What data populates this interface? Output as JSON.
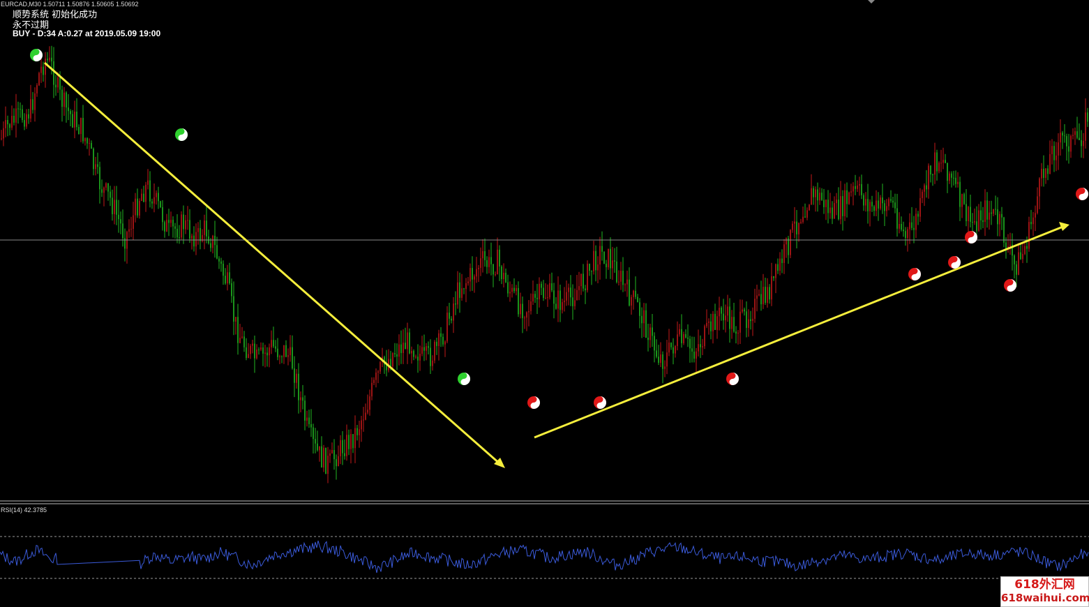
{
  "header": {
    "symbol_quote": "EURCAD,M30  1.50711 1.50876 1.50605 1.50692",
    "status": "顺势系统 初始化成功",
    "expiry": "永不过期",
    "signal": "BUY - D:34 A:0.27 at 2019.05.09 19:00"
  },
  "rsi_panel": {
    "label": "RSI(14) 42.3785",
    "period": 14,
    "value": 42.3785,
    "upper_level": 70,
    "lower_level": 30,
    "line_color": "#3b5bdb"
  },
  "watermark": {
    "line1": "618外汇网",
    "line2": "618waihui.com"
  },
  "colors": {
    "background": "#000000",
    "bull_bar": "#c41a1a",
    "bear_bar": "#22b822",
    "trend_arrow": "#f5ee3c",
    "buy_marker": "#2fd12f",
    "sell_marker": "#e01818",
    "horizontal_line": "#8a8a8a"
  },
  "icons": {
    "marker": "yin-yang-icon"
  },
  "chart_data": {
    "type": "candlestick",
    "timeframe": "M30",
    "symbol": "EURCAD",
    "price_path": [
      0.25,
      0.22,
      0.21,
      0.2,
      0.19,
      0.12,
      0.08,
      0.1,
      0.16,
      0.19,
      0.21,
      0.23,
      0.27,
      0.33,
      0.36,
      0.38,
      0.42,
      0.46,
      0.42,
      0.37,
      0.35,
      0.38,
      0.41,
      0.45,
      0.44,
      0.43,
      0.45,
      0.46,
      0.44,
      0.47,
      0.52,
      0.56,
      0.64,
      0.68,
      0.7,
      0.72,
      0.71,
      0.69,
      0.7,
      0.7,
      0.73,
      0.8,
      0.87,
      0.91,
      0.93,
      0.94,
      0.92,
      0.9,
      0.89,
      0.86,
      0.82,
      0.78,
      0.74,
      0.72,
      0.7,
      0.69,
      0.68,
      0.7,
      0.72,
      0.71,
      0.69,
      0.65,
      0.6,
      0.56,
      0.55,
      0.53,
      0.51,
      0.52,
      0.51,
      0.55,
      0.58,
      0.6,
      0.61,
      0.6,
      0.58,
      0.58,
      0.59,
      0.6,
      0.59,
      0.57,
      0.55,
      0.52,
      0.49,
      0.5,
      0.52,
      0.55,
      0.58,
      0.6,
      0.63,
      0.67,
      0.71,
      0.72,
      0.69,
      0.68,
      0.69,
      0.7,
      0.68,
      0.66,
      0.63,
      0.62,
      0.64,
      0.65,
      0.63,
      0.61,
      0.6,
      0.58,
      0.55,
      0.51,
      0.47,
      0.43,
      0.4,
      0.37,
      0.37,
      0.39,
      0.41,
      0.4,
      0.38,
      0.36,
      0.37,
      0.39,
      0.4,
      0.39,
      0.38,
      0.42,
      0.46,
      0.44,
      0.4,
      0.34,
      0.3,
      0.29,
      0.32,
      0.36,
      0.4,
      0.43,
      0.42,
      0.4,
      0.41,
      0.43,
      0.48,
      0.52,
      0.5,
      0.45,
      0.38,
      0.32,
      0.28,
      0.26,
      0.25,
      0.26,
      0.25,
      0.2
    ],
    "rsi_path": [
      0.55,
      0.5,
      0.45,
      0.5,
      0.58,
      0.62,
      0.55,
      0.48,
      0.5,
      0.56,
      0.6,
      0.5,
      0.4,
      0.35,
      0.45,
      0.5,
      0.42,
      0.35,
      0.3,
      0.42,
      0.5,
      0.55,
      0.5,
      0.45,
      0.48,
      0.5,
      0.52,
      0.48,
      0.5,
      0.56,
      0.58,
      0.54,
      0.5,
      0.44,
      0.4,
      0.45,
      0.5,
      0.55,
      0.58,
      0.6,
      0.62,
      0.64,
      0.66,
      0.68,
      0.66,
      0.62,
      0.6,
      0.55,
      0.5,
      0.45,
      0.4,
      0.36,
      0.4,
      0.45,
      0.5,
      0.55,
      0.58,
      0.56,
      0.52,
      0.5,
      0.48,
      0.45,
      0.42,
      0.4,
      0.42,
      0.46,
      0.5,
      0.55,
      0.58,
      0.6,
      0.62,
      0.6,
      0.58,
      0.55,
      0.5,
      0.52,
      0.54,
      0.56,
      0.58,
      0.6,
      0.55,
      0.5,
      0.45,
      0.4,
      0.42,
      0.46,
      0.5,
      0.56,
      0.6,
      0.62,
      0.64,
      0.66,
      0.65,
      0.62,
      0.58,
      0.55,
      0.52,
      0.5,
      0.48,
      0.5,
      0.52,
      0.5,
      0.48,
      0.46,
      0.45,
      0.44,
      0.42,
      0.4,
      0.38,
      0.42,
      0.46,
      0.48,
      0.5,
      0.52,
      0.54,
      0.52,
      0.5,
      0.48,
      0.5,
      0.52,
      0.54,
      0.56,
      0.58,
      0.56,
      0.52,
      0.5,
      0.48,
      0.46,
      0.5,
      0.54,
      0.56,
      0.58,
      0.56,
      0.54,
      0.55,
      0.56,
      0.58,
      0.6,
      0.58,
      0.55,
      0.5,
      0.45,
      0.4,
      0.38,
      0.42,
      0.5,
      0.55,
      0.52
    ]
  }
}
